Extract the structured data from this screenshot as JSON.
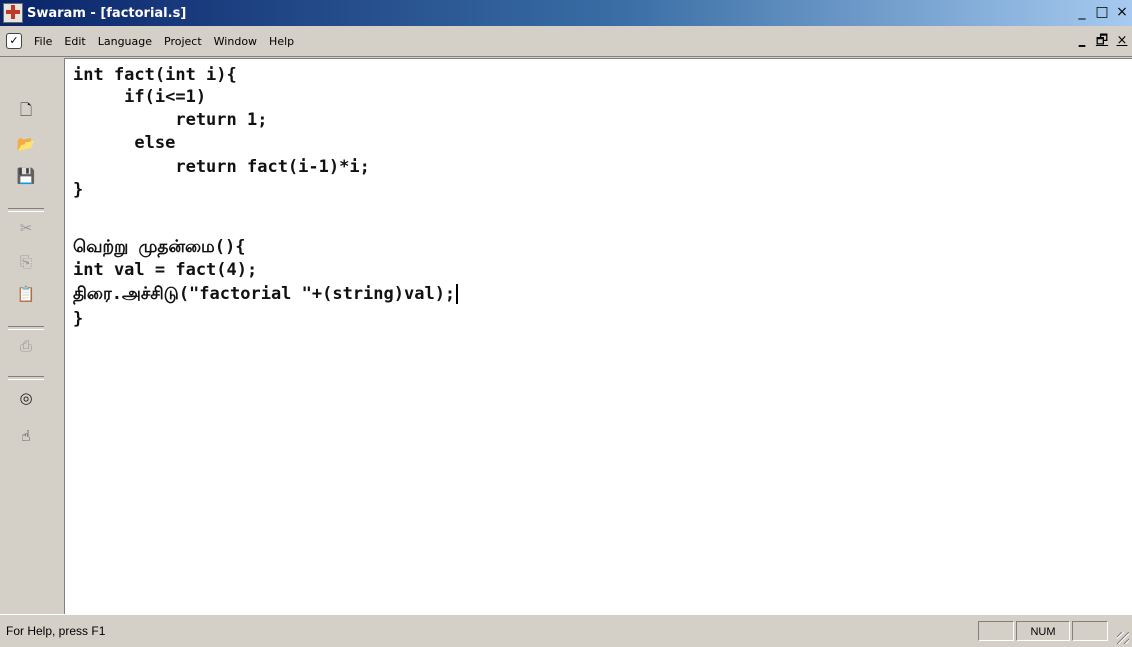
{
  "window": {
    "title": "Swaram - [factorial.s]",
    "controls": {
      "minimize": "_",
      "maximize": "□",
      "close": "×"
    },
    "mdi_controls": {
      "minimize": "_",
      "restore": "🗗",
      "close": "×"
    }
  },
  "menubar": {
    "items": [
      {
        "label": "File"
      },
      {
        "label": "Edit"
      },
      {
        "label": "Language"
      },
      {
        "label": "Project"
      },
      {
        "label": "Window"
      },
      {
        "label": "Help"
      }
    ]
  },
  "toolbar": {
    "buttons": [
      {
        "name": "new-file-icon",
        "glyph": "🗋",
        "enabled": true
      },
      {
        "name": "open-folder-icon",
        "glyph": "📂",
        "enabled": true
      },
      {
        "name": "save-icon",
        "glyph": "💾",
        "enabled": true
      },
      {
        "name": "cut-icon",
        "glyph": "✂",
        "enabled": false
      },
      {
        "name": "copy-icon",
        "glyph": "⎘",
        "enabled": false
      },
      {
        "name": "paste-icon",
        "glyph": "📋",
        "enabled": true
      },
      {
        "name": "print-icon",
        "glyph": "⎙",
        "enabled": false
      },
      {
        "name": "view-icon",
        "glyph": "◎",
        "enabled": true
      },
      {
        "name": "help-pointer-icon",
        "glyph": "☝",
        "enabled": true
      }
    ]
  },
  "editor": {
    "lines": [
      "int fact(int i){",
      "     if(i<=1)",
      "          return 1;",
      "      else",
      "          return fact(i-1)*i;",
      "}",
      "",
      "வெற்று முதன்மை(){",
      "int val = fact(4);",
      "திரை.அச்சிடு(\"factorial \"+(string)val);",
      "}"
    ]
  },
  "statusbar": {
    "help_text": "For Help, press F1",
    "num_indicator": "NUM"
  }
}
